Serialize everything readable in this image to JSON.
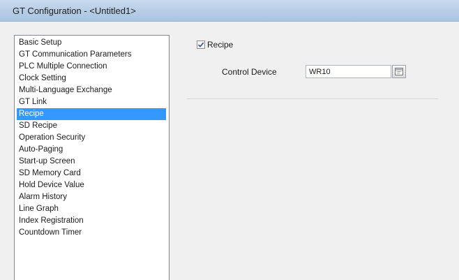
{
  "window": {
    "title": "GT Configuration - <Untitled1>"
  },
  "sidebar": {
    "items": [
      {
        "label": "Basic Setup",
        "selected": false
      },
      {
        "label": "GT Communication Parameters",
        "selected": false
      },
      {
        "label": "PLC Multiple Connection",
        "selected": false
      },
      {
        "label": "Clock Setting",
        "selected": false
      },
      {
        "label": "Multi-Language Exchange",
        "selected": false
      },
      {
        "label": "GT Link",
        "selected": false
      },
      {
        "label": "Recipe",
        "selected": true
      },
      {
        "label": "SD Recipe",
        "selected": false
      },
      {
        "label": "Operation Security",
        "selected": false
      },
      {
        "label": "Auto-Paging",
        "selected": false
      },
      {
        "label": "Start-up Screen",
        "selected": false
      },
      {
        "label": "SD Memory Card",
        "selected": false
      },
      {
        "label": "Hold Device Value",
        "selected": false
      },
      {
        "label": "Alarm History",
        "selected": false
      },
      {
        "label": "Line Graph",
        "selected": false
      },
      {
        "label": "Index Registration",
        "selected": false
      },
      {
        "label": "Countdown Timer",
        "selected": false
      }
    ],
    "selected_color": "#3399ff"
  },
  "panel": {
    "recipe_checkbox": {
      "label": "Recipe",
      "checked": true
    },
    "control_device": {
      "label": "Control Device",
      "value": "WR10",
      "browse_icon": "browse-icon"
    }
  }
}
